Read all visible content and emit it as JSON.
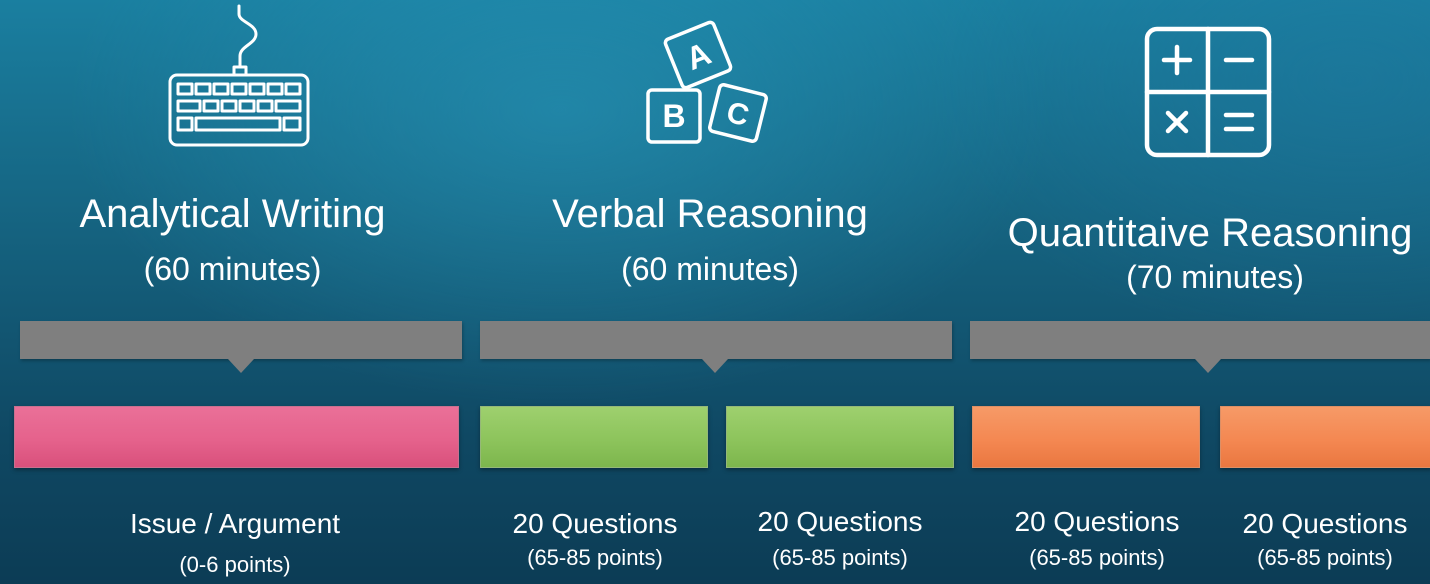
{
  "sections": [
    {
      "icon": "keyboard-icon",
      "title": "Analytical Writing",
      "duration": "(60 minutes)"
    },
    {
      "icon": "abc-blocks-icon",
      "title": "Verbal Reasoning",
      "duration": "(60 minutes)",
      "block_letters": [
        "A",
        "B",
        "C"
      ]
    },
    {
      "icon": "calculator-icon",
      "title": "Quantitaive Reasoning",
      "duration": "(70 minutes)"
    }
  ],
  "tasks": [
    {
      "label": "Issue / Argument",
      "points": "(0-6 points)",
      "color": "#e5628c"
    },
    {
      "label": "20 Questions",
      "points": "(65-85 points)",
      "color": "#8dc45c"
    },
    {
      "label": "20 Questions",
      "points": "(65-85 points)",
      "color": "#8dc45c"
    },
    {
      "label": "20 Questions",
      "points": "(65-85 points)",
      "color": "#f48852"
    },
    {
      "label": "20 Questions",
      "points": "(65-85 points)",
      "color": "#f48852"
    }
  ],
  "colors": {
    "connector": "#7f7f7f",
    "writing": "#e5628c",
    "verbal": "#8dc45c",
    "quant": "#f48852"
  }
}
